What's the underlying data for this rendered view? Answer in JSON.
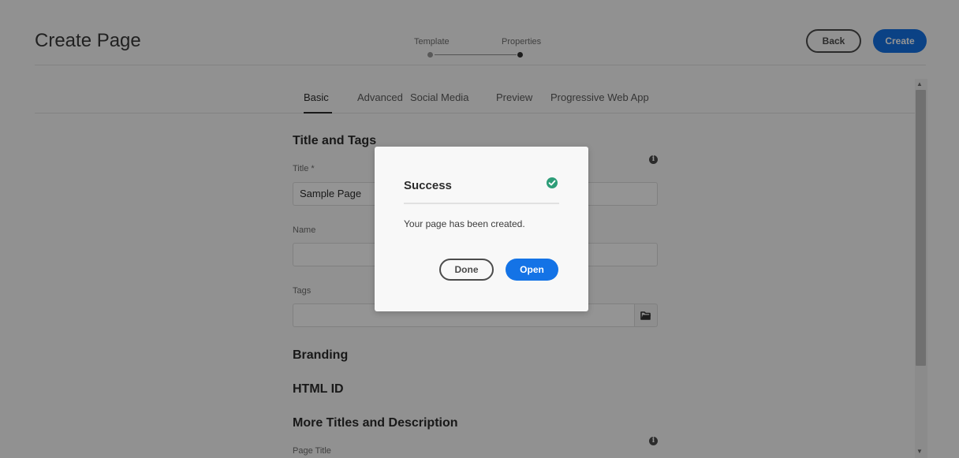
{
  "header": {
    "title": "Create Page",
    "steps": [
      {
        "label": "Template",
        "state": "completed"
      },
      {
        "label": "Properties",
        "state": "current"
      }
    ],
    "back_label": "Back",
    "create_label": "Create"
  },
  "tabs": [
    {
      "label": "Basic",
      "active": true
    },
    {
      "label": "Advanced",
      "active": false
    },
    {
      "label": "Social Media",
      "active": false
    },
    {
      "label": "Preview",
      "active": false
    },
    {
      "label": "Progressive Web App",
      "active": false
    }
  ],
  "form": {
    "section_title_tags": "Title and Tags",
    "title_label": "Title *",
    "title_value": "Sample Page",
    "name_label": "Name",
    "name_value": "",
    "tags_label": "Tags",
    "tags_value": "",
    "section_branding": "Branding",
    "section_html_id": "HTML ID",
    "section_more_titles": "More Titles and Description",
    "page_title_label": "Page Title"
  },
  "dialog": {
    "title": "Success",
    "message": "Your page has been created.",
    "done_label": "Done",
    "open_label": "Open"
  },
  "icons": {
    "info": "info-icon",
    "folder": "folder-icon",
    "success": "checkmark-circle-icon"
  },
  "colors": {
    "accent": "#1473e6",
    "success": "#2d9d78"
  }
}
